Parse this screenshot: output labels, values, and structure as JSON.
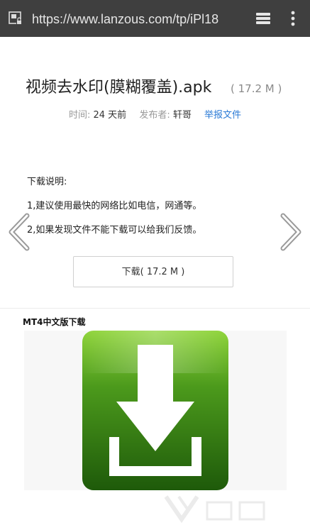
{
  "browser": {
    "url": "https://www.lanzous.com/tp/iPl18"
  },
  "file": {
    "title": "视频去水印(膜糊覆盖).apk",
    "size": "( 17.2 M )"
  },
  "meta": {
    "time_label": "时间:",
    "time_value": "24 天前",
    "publisher_label": "发布者:",
    "publisher_value": "轩哥",
    "report_link": "举报文件"
  },
  "notes": {
    "heading": "下载说明:",
    "line1": "1,建议使用最快的网络比如电信，网通等。",
    "line2": "2,如果发现文件不能下载可以给我们反馈。"
  },
  "download": {
    "label": "下载( 17.2 M )"
  },
  "section": {
    "title": "MT4中文版下载"
  },
  "colors": {
    "browser_bar": "#3f3f3f",
    "link": "#2a7ad6",
    "icon_green_dark": "#2f6f12",
    "icon_green_light": "#6fbf2a"
  }
}
